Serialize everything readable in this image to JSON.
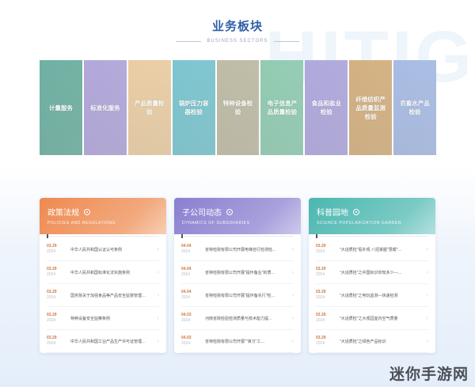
{
  "deco_text": "HITIG",
  "header": {
    "title_cn": "业务板块",
    "title_en": "BUSINESS SECTORS"
  },
  "tiles": [
    {
      "label": "计量服务",
      "color": "#5fa898"
    },
    {
      "label": "标准化服务",
      "color": "#a99ed6"
    },
    {
      "label": "产品质量检验",
      "color": "#e7c89b"
    },
    {
      "label": "锅炉压力容器检验",
      "color": "#6ebfca"
    },
    {
      "label": "特种设备检验",
      "color": "#b7b49c"
    },
    {
      "label": "电子信息产品质量检验",
      "color": "#86c6aa"
    },
    {
      "label": "食品和盐业检验",
      "color": "#a79fd9"
    },
    {
      "label": "纤维纺织产品质量监测检验",
      "color": "#cfa873"
    },
    {
      "label": "农畜水产品检验",
      "color": "#9fb5e0"
    }
  ],
  "cards": [
    {
      "title": "政策法规",
      "subtitle": "POLICIES AND REGULATIONS",
      "head_color": "#ee8a4f",
      "items": [
        {
          "date": "03.29",
          "year": "2024",
          "text": "中华人民共和国认证认可条例"
        },
        {
          "date": "03.29",
          "year": "2024",
          "text": "中华人民共和国标准化法实施条例"
        },
        {
          "date": "03.29",
          "year": "2024",
          "text": "国务院关于加强食品等产品安全监督管理…"
        },
        {
          "date": "03.29",
          "year": "2024",
          "text": "特种设备安全监察条例"
        },
        {
          "date": "03.29",
          "year": "2024",
          "text": "中华人民共和国工业产品生产许可证管理…"
        }
      ]
    },
    {
      "title": "子公司动态",
      "subtitle": "DYNAMICS OF SUBSIDIARIES",
      "head_color": "#8a7fd0",
      "items": [
        {
          "date": "04.04",
          "year": "2024",
          "text": "省特检院有限公司开展电梯自行检测检…"
        },
        {
          "date": "04.04",
          "year": "2024",
          "text": "省特检院有限公司开展\"提环备业\"的质…"
        },
        {
          "date": "04.04",
          "year": "2024",
          "text": "省特检院有限公司开展\"提环备先行\"检…"
        },
        {
          "date": "04.03",
          "year": "2024",
          "text": "河南省院检验检测质量与技术能力提…"
        },
        {
          "date": "04.03",
          "year": "2024",
          "text": "省特检院有限公司开展\"\"演习\"工…"
        }
      ]
    },
    {
      "title": "科普园地",
      "subtitle": "SCIENCE POPULARIZATION GARDEN",
      "head_color": "#4bb7b0",
      "items": [
        {
          "date": "03.29",
          "year": "2024",
          "text": "\"大话质检\"看外观 八招掌握\"慧眼\"…"
        },
        {
          "date": "03.29",
          "year": "2024",
          "text": "\"大话质检\"之中国标识你知多少—…"
        },
        {
          "date": "03.29",
          "year": "2024",
          "text": "\"大话质检\"之电玩监测—快速检测"
        },
        {
          "date": "03.29",
          "year": "2024",
          "text": "\"大话质检\"之大观园室内空气质量"
        },
        {
          "date": "03.29",
          "year": "2024",
          "text": "\"大话质检\"之绿色产品标识"
        }
      ]
    }
  ],
  "watermark": "迷你手游网"
}
